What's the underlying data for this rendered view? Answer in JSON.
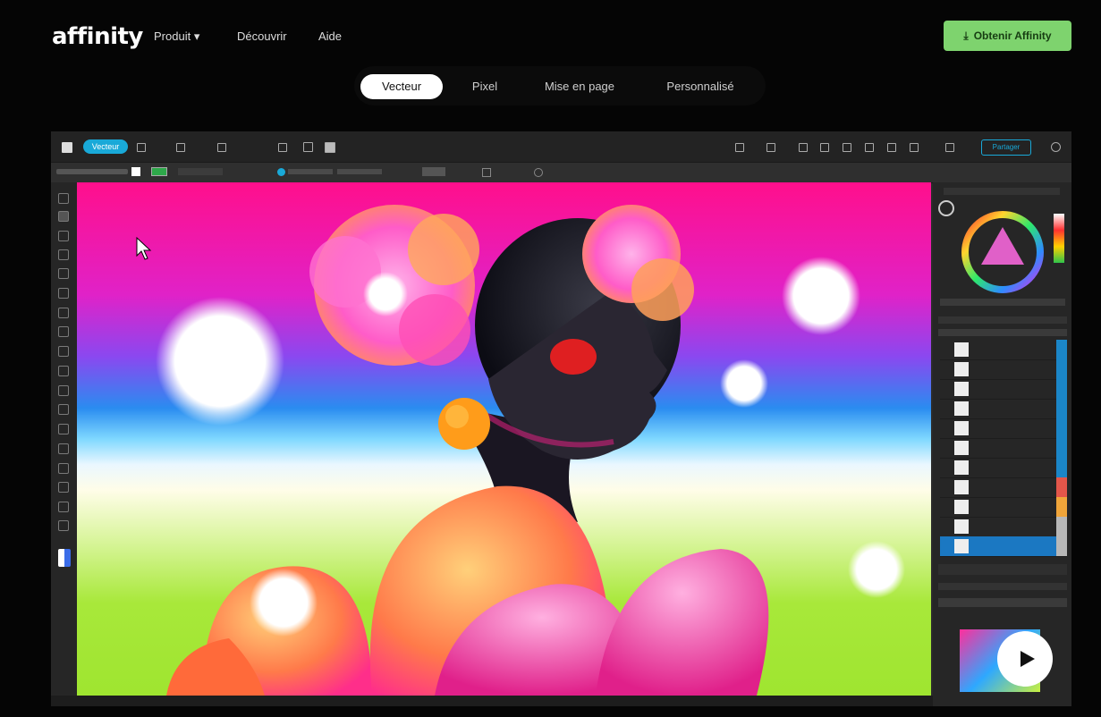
{
  "nav": {
    "logo": "affinity",
    "links": [
      "Produit",
      "Découvrir",
      "Aide"
    ],
    "cta_label": "Obtenir Affinity"
  },
  "segments": {
    "items": [
      "Vecteur",
      "Pixel",
      "Mise en page",
      "Personnalisé"
    ],
    "active_index": 0
  },
  "app": {
    "persona_label": "Vecteur",
    "share_label": "Partager",
    "layers": [
      {
        "name": "",
        "swatch": "#1b86c8"
      },
      {
        "name": "",
        "swatch": "#1b86c8"
      },
      {
        "name": "",
        "swatch": "#1b86c8"
      },
      {
        "name": "",
        "swatch": "#1b86c8"
      },
      {
        "name": "",
        "swatch": "#1b86c8"
      },
      {
        "name": "",
        "swatch": "#1b86c8"
      },
      {
        "name": "",
        "swatch": "#1b86c8"
      },
      {
        "name": "",
        "swatch": "#e3564a"
      },
      {
        "name": "",
        "swatch": "#f0a53a"
      },
      {
        "name": "",
        "swatch": "#b8b8b8"
      },
      {
        "name": "",
        "swatch": "#b8b8b8"
      }
    ]
  },
  "video": {
    "play_icon": "play-icon"
  },
  "colors": {
    "accent_green": "#7ed36e",
    "persona_blue": "#19a9d8",
    "layer_selected": "#1b78c2"
  }
}
